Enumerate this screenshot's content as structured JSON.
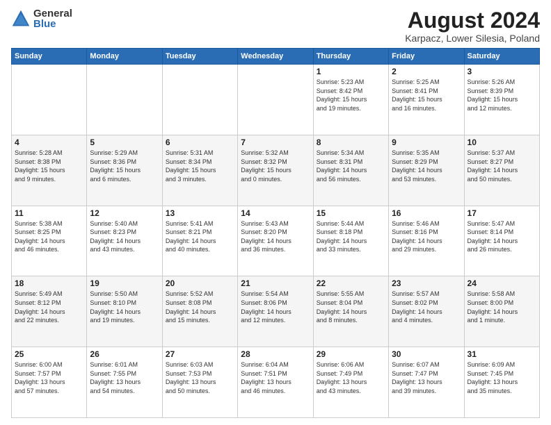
{
  "logo": {
    "general": "General",
    "blue": "Blue"
  },
  "header": {
    "title": "August 2024",
    "subtitle": "Karpacz, Lower Silesia, Poland"
  },
  "weekdays": [
    "Sunday",
    "Monday",
    "Tuesday",
    "Wednesday",
    "Thursday",
    "Friday",
    "Saturday"
  ],
  "weeks": [
    [
      {
        "day": "",
        "info": ""
      },
      {
        "day": "",
        "info": ""
      },
      {
        "day": "",
        "info": ""
      },
      {
        "day": "",
        "info": ""
      },
      {
        "day": "1",
        "info": "Sunrise: 5:23 AM\nSunset: 8:42 PM\nDaylight: 15 hours\nand 19 minutes."
      },
      {
        "day": "2",
        "info": "Sunrise: 5:25 AM\nSunset: 8:41 PM\nDaylight: 15 hours\nand 16 minutes."
      },
      {
        "day": "3",
        "info": "Sunrise: 5:26 AM\nSunset: 8:39 PM\nDaylight: 15 hours\nand 12 minutes."
      }
    ],
    [
      {
        "day": "4",
        "info": "Sunrise: 5:28 AM\nSunset: 8:38 PM\nDaylight: 15 hours\nand 9 minutes."
      },
      {
        "day": "5",
        "info": "Sunrise: 5:29 AM\nSunset: 8:36 PM\nDaylight: 15 hours\nand 6 minutes."
      },
      {
        "day": "6",
        "info": "Sunrise: 5:31 AM\nSunset: 8:34 PM\nDaylight: 15 hours\nand 3 minutes."
      },
      {
        "day": "7",
        "info": "Sunrise: 5:32 AM\nSunset: 8:32 PM\nDaylight: 15 hours\nand 0 minutes."
      },
      {
        "day": "8",
        "info": "Sunrise: 5:34 AM\nSunset: 8:31 PM\nDaylight: 14 hours\nand 56 minutes."
      },
      {
        "day": "9",
        "info": "Sunrise: 5:35 AM\nSunset: 8:29 PM\nDaylight: 14 hours\nand 53 minutes."
      },
      {
        "day": "10",
        "info": "Sunrise: 5:37 AM\nSunset: 8:27 PM\nDaylight: 14 hours\nand 50 minutes."
      }
    ],
    [
      {
        "day": "11",
        "info": "Sunrise: 5:38 AM\nSunset: 8:25 PM\nDaylight: 14 hours\nand 46 minutes."
      },
      {
        "day": "12",
        "info": "Sunrise: 5:40 AM\nSunset: 8:23 PM\nDaylight: 14 hours\nand 43 minutes."
      },
      {
        "day": "13",
        "info": "Sunrise: 5:41 AM\nSunset: 8:21 PM\nDaylight: 14 hours\nand 40 minutes."
      },
      {
        "day": "14",
        "info": "Sunrise: 5:43 AM\nSunset: 8:20 PM\nDaylight: 14 hours\nand 36 minutes."
      },
      {
        "day": "15",
        "info": "Sunrise: 5:44 AM\nSunset: 8:18 PM\nDaylight: 14 hours\nand 33 minutes."
      },
      {
        "day": "16",
        "info": "Sunrise: 5:46 AM\nSunset: 8:16 PM\nDaylight: 14 hours\nand 29 minutes."
      },
      {
        "day": "17",
        "info": "Sunrise: 5:47 AM\nSunset: 8:14 PM\nDaylight: 14 hours\nand 26 minutes."
      }
    ],
    [
      {
        "day": "18",
        "info": "Sunrise: 5:49 AM\nSunset: 8:12 PM\nDaylight: 14 hours\nand 22 minutes."
      },
      {
        "day": "19",
        "info": "Sunrise: 5:50 AM\nSunset: 8:10 PM\nDaylight: 14 hours\nand 19 minutes."
      },
      {
        "day": "20",
        "info": "Sunrise: 5:52 AM\nSunset: 8:08 PM\nDaylight: 14 hours\nand 15 minutes."
      },
      {
        "day": "21",
        "info": "Sunrise: 5:54 AM\nSunset: 8:06 PM\nDaylight: 14 hours\nand 12 minutes."
      },
      {
        "day": "22",
        "info": "Sunrise: 5:55 AM\nSunset: 8:04 PM\nDaylight: 14 hours\nand 8 minutes."
      },
      {
        "day": "23",
        "info": "Sunrise: 5:57 AM\nSunset: 8:02 PM\nDaylight: 14 hours\nand 4 minutes."
      },
      {
        "day": "24",
        "info": "Sunrise: 5:58 AM\nSunset: 8:00 PM\nDaylight: 14 hours\nand 1 minute."
      }
    ],
    [
      {
        "day": "25",
        "info": "Sunrise: 6:00 AM\nSunset: 7:57 PM\nDaylight: 13 hours\nand 57 minutes."
      },
      {
        "day": "26",
        "info": "Sunrise: 6:01 AM\nSunset: 7:55 PM\nDaylight: 13 hours\nand 54 minutes."
      },
      {
        "day": "27",
        "info": "Sunrise: 6:03 AM\nSunset: 7:53 PM\nDaylight: 13 hours\nand 50 minutes."
      },
      {
        "day": "28",
        "info": "Sunrise: 6:04 AM\nSunset: 7:51 PM\nDaylight: 13 hours\nand 46 minutes."
      },
      {
        "day": "29",
        "info": "Sunrise: 6:06 AM\nSunset: 7:49 PM\nDaylight: 13 hours\nand 43 minutes."
      },
      {
        "day": "30",
        "info": "Sunrise: 6:07 AM\nSunset: 7:47 PM\nDaylight: 13 hours\nand 39 minutes."
      },
      {
        "day": "31",
        "info": "Sunrise: 6:09 AM\nSunset: 7:45 PM\nDaylight: 13 hours\nand 35 minutes."
      }
    ]
  ]
}
